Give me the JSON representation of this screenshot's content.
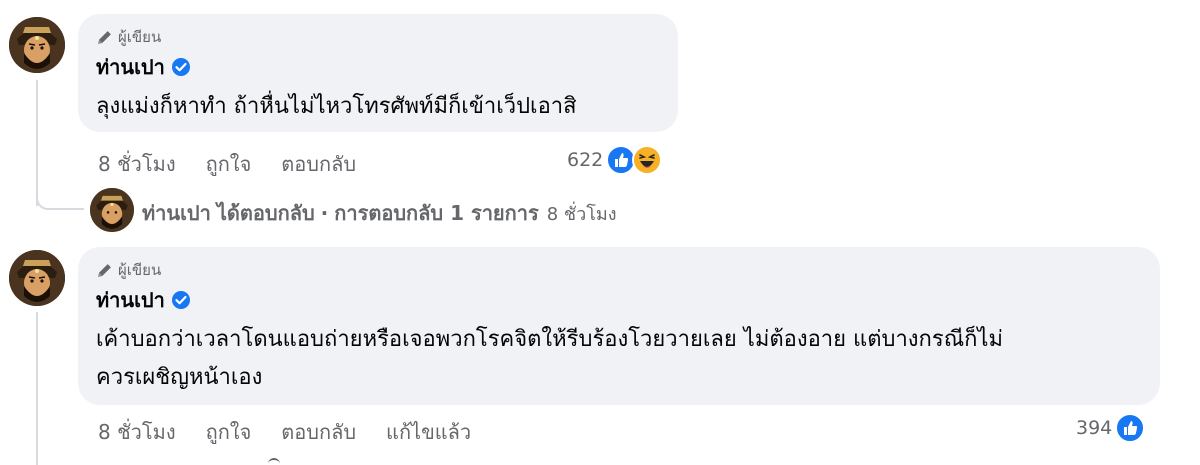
{
  "comments": [
    {
      "author_badge": "ผู้เขียน",
      "name": "ท่านเปา",
      "text": "ลุงแม่งก็หาทำ ถ้าหื่นไม่ไหวโทรศัพท์มีก็เข้าเว็ปเอาสิ",
      "time": "8 ชั่วโมง",
      "like_label": "ถูกใจ",
      "reply_label": "ตอบกลับ",
      "reaction_count": "622",
      "reactions": [
        "like-icon",
        "haha-icon"
      ],
      "reply_summary": {
        "name": "ท่านเปา",
        "action": "ได้ตอบกลับ",
        "separator": "·",
        "count_text": "การตอบกลับ 1 รายการ",
        "time": "8 ชั่วโมง"
      }
    },
    {
      "author_badge": "ผู้เขียน",
      "name": "ท่านเปา",
      "text_line1": "เค้าบอกว่าเวลาโดนแอบถ่ายหรือเจอพวกโรคจิตให้รีบร้องโวยวายเลย ไม่ต้องอาย แต่บางกรณีก็ไม่",
      "text_line2": "ควรเผชิญหน้าเอง",
      "time": "8 ชั่วโมง",
      "like_label": "ถูกใจ",
      "reply_label": "ตอบกลับ",
      "edited_label": "แก้ไขแล้ว",
      "reaction_count": "394",
      "reactions": [
        "like-icon"
      ]
    }
  ],
  "colors": {
    "bubble_bg": "#f0f2f5",
    "meta_text": "#65676b",
    "verified_blue": "#1877f2",
    "like_blue": "#1877f2",
    "haha_yellow": "#f7b125"
  }
}
